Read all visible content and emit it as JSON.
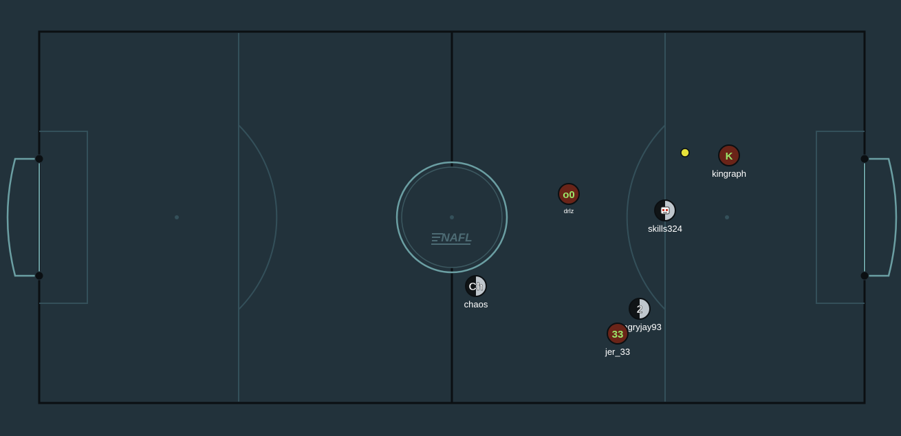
{
  "colors": {
    "background": "#22323b",
    "pitch": "#22323b",
    "pitch_border": "#0b0f12",
    "pitch_lines": "#34505a",
    "goal_lines": "#6b9fa3",
    "center_ring": "#6b9fa3",
    "ball": "#e6e23a",
    "red_team": "#6a2418",
    "red_text": "#9be86a",
    "grey_team_dark": "#101416",
    "grey_team_light": "#bfc6cc",
    "name_text": "#ffffff"
  },
  "pitch": {
    "logo_text": "NAFL"
  },
  "ball": {
    "icon": "ball-icon"
  },
  "players": [
    {
      "id": "kingraph",
      "name": "kingraph",
      "avatar": "K",
      "team": "red"
    },
    {
      "id": "drlz",
      "name": "drlz",
      "avatar": "o0",
      "team": "red"
    },
    {
      "id": "skills324",
      "name": "skills324",
      "avatar": "",
      "avatar_icon": "robot-face-icon",
      "team": "grey"
    },
    {
      "id": "chaos",
      "name": "chaos",
      "avatar": "Ch",
      "team": "grey"
    },
    {
      "id": "angryjay93",
      "name": "angryjay93",
      "avatar": "2",
      "team": "grey"
    },
    {
      "id": "jer_33",
      "name": "jer_33",
      "avatar": "33",
      "team": "red"
    }
  ]
}
